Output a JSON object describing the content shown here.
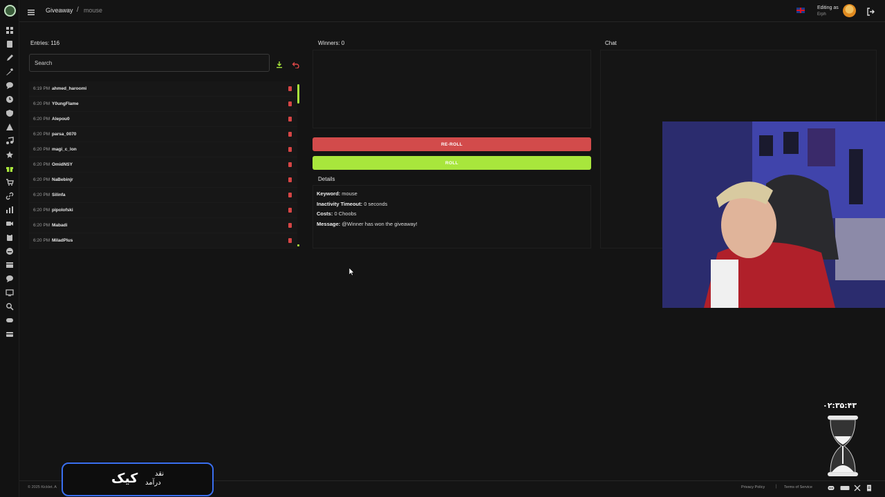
{
  "header": {
    "breadcrumb_root": "Giveaway",
    "breadcrumb_separator": "/",
    "breadcrumb_current": "mouse",
    "editing_label": "Editing as",
    "editing_user": "Erph"
  },
  "sidebar": {
    "icons": [
      "dashboard-icon",
      "document-icon",
      "pen-icon",
      "tools-icon",
      "chat-icon",
      "clock-icon",
      "shield-icon",
      "alert-icon",
      "music-icon",
      "star-icon",
      "gift-icon",
      "cart-icon",
      "link-icon",
      "chart-icon",
      "video-icon",
      "clipboard-icon",
      "emoji-icon",
      "film-icon",
      "speech-icon",
      "monitor-icon",
      "search-icon",
      "gamepad-icon",
      "card-icon"
    ],
    "active": "gift-icon"
  },
  "entries_panel": {
    "title": "Entries: 116",
    "search_placeholder": "Search",
    "entries": [
      {
        "time": "6:19 PM",
        "name": "ahmed_haroomi"
      },
      {
        "time": "6:20 PM",
        "name": "Y0ungFlame"
      },
      {
        "time": "6:20 PM",
        "name": "Alepou0"
      },
      {
        "time": "6:20 PM",
        "name": "parsa_0070"
      },
      {
        "time": "6:20 PM",
        "name": "magi_c_lon"
      },
      {
        "time": "6:20 PM",
        "name": "OmidNSY"
      },
      {
        "time": "6:20 PM",
        "name": "NaBebinjr"
      },
      {
        "time": "6:20 PM",
        "name": "Silinfa"
      },
      {
        "time": "6:20 PM",
        "name": "pipolofski"
      },
      {
        "time": "6:20 PM",
        "name": "Mabadi"
      },
      {
        "time": "6:20 PM",
        "name": "MiladPlus"
      }
    ]
  },
  "winners_panel": {
    "title": "Winners: 0",
    "reroll_label": "RE-ROLL",
    "roll_label": "ROLL"
  },
  "details": {
    "title": "Details",
    "keyword_label": "Keyword:",
    "keyword_value": "mouse",
    "timeout_label": "Inactivity Timeout:",
    "timeout_value": "0 seconds",
    "costs_label": "Costs:",
    "costs_value": "0 Choobs",
    "message_label": "Message:",
    "message_value": "@Winner has won the giveaway!"
  },
  "chat_panel": {
    "title": "Chat"
  },
  "overlay": {
    "timer": "۰۲:۳۵:۴۳",
    "kick_big": "کیک",
    "kick_small_top": "نقد",
    "kick_small_bottom": "درآمد"
  },
  "footer": {
    "copyright": "© 2025 Kicklet. A",
    "privacy": "Privacy Policy",
    "separator": "|",
    "terms": "Terms of Service",
    "social_icons": [
      "discord-icon",
      "kick-icon",
      "x-icon",
      "document-icon"
    ]
  },
  "colors": {
    "accent_green": "#a8e63c",
    "danger_red": "#d24b4b",
    "background": "#141414"
  }
}
